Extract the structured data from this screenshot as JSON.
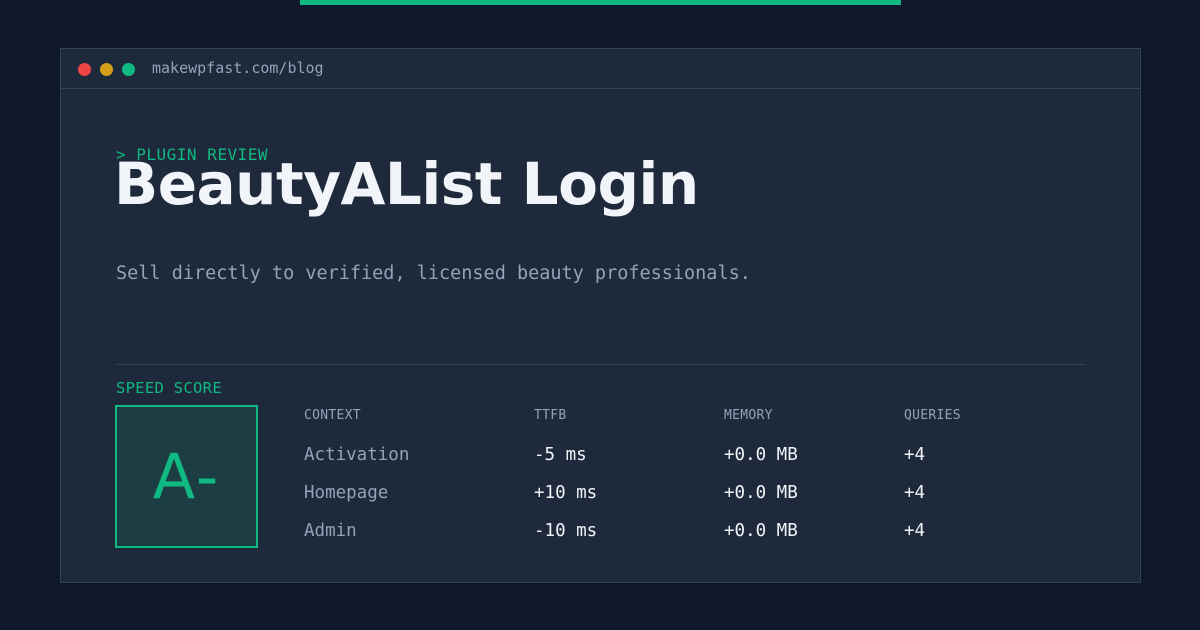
{
  "window": {
    "url": "makewpfast.com/blog"
  },
  "post": {
    "kicker": "> PLUGIN REVIEW",
    "title": "BeautyAList Login",
    "description": "Sell directly to verified, licensed beauty professionals."
  },
  "score": {
    "label": "SPEED SCORE",
    "grade": "A-"
  },
  "table": {
    "headers": [
      "CONTEXT",
      "TTFB",
      "MEMORY",
      "QUERIES"
    ],
    "rows": [
      [
        "Activation",
        "-5 ms",
        "+0.0 MB",
        "+4"
      ],
      [
        "Homepage",
        "+10 ms",
        "+0.0 MB",
        "+4"
      ],
      [
        "Admin",
        "-10 ms",
        "+0.0 MB",
        "+4"
      ]
    ]
  },
  "colors": {
    "accent": "#10b981",
    "background": "#0f172a",
    "panel": "#1e293b"
  }
}
